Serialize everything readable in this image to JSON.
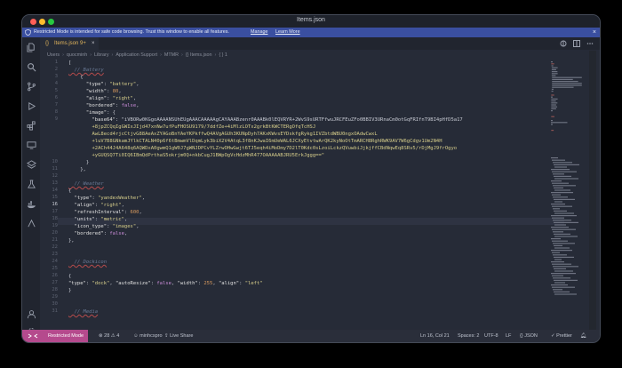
{
  "window": {
    "title": "Items.json"
  },
  "banner": {
    "message": "Restricted Mode is intended for safe code browsing. Trust this window to enable all features.",
    "manage": "Manage",
    "learn_more": "Learn More"
  },
  "activity": [
    "files-icon",
    "search-icon",
    "source-control-icon",
    "run-debug-icon",
    "extensions-icon",
    "remote-explorer-icon",
    "docker-icon",
    "testing-icon",
    "accounts-icon",
    "settings-icon"
  ],
  "tab": {
    "icon": "{}",
    "name": "Items.json",
    "badge": "9+",
    "close": "×"
  },
  "breadcrumbs": [
    "Users",
    "quocminh",
    "Library",
    "Application Support",
    "MTMR",
    "{} Items.json",
    "{ } 1"
  ],
  "lines": [
    {
      "n": "1",
      "t": "["
    },
    {
      "n": "2",
      "t": "  // Battery"
    },
    {
      "n": "3",
      "t": "    {"
    },
    {
      "n": "4",
      "t": "      \"type\": \"battery\","
    },
    {
      "n": "5",
      "t": "      \"width\": 80,"
    },
    {
      "n": "6",
      "t": "      \"align\": \"right\","
    },
    {
      "n": "7",
      "t": "      \"bordered\": false,"
    },
    {
      "n": "8",
      "t": "      \"image\": {"
    },
    {
      "n": "9",
      "t": "        \"base64\": \"iVBORw0KGgoAAAANSUhEUgAAACAAAAAgCAYAAABzenr0AAABk0lEQVRYR+2WvS9sURTFfwuJRCFEuZFo0BBIV3URnaCm0otGqFRIfnT9BI4pHfD5a17"
    },
    {
      "n": "",
      "t": "        +8jpZCQqIgGWIxJIjd47xnNw7ufPuFHOSU9179/7ddfZe+4iMlzLOTx2grkBtKWCTERgOfqTcHSJ"
    },
    {
      "n": "",
      "t": "        AwL8ecd4rjcCtjvG88AeAxZYAGoBnYAeYKPkffwQ4AVgAGUh3KUNpDyh7AKxKWvsEYDskfgRykg1IVZbtdWBU0ngxOAdwCwxL"
    },
    {
      "n": "",
      "t": "        +luV7B8GNkamJYlkCTALN40p6f6tBmwmVlDqmLyk3biX2V4AtqL3f8nKJwaI6mUeWAL6JCXyEtvtwArQK2kyNoOtTmARCH8RghRWK9AV7W6gCdgv1Um2N4H"
    },
    {
      "n": "",
      "t": "        +2ACh44J4A648q6AQWDxA0gwmQ1gW0J7gWNJDPCvYLZrwOHwGwjt6TJ5eqh4iMoDmy7D2lT0Kdc0sLzoiLckzQVuwbiJjkjffCBdNqwEq8SRv5/rDjMgJ9frOgyo"
    },
    {
      "n": "",
      "t": "        +yGUQSQ7Ti0IQ6IBmQdPrthaS5okrjm0Q+nkbCugJ1BWpOgVcHdzMhR477OAAAAABJRU5ErkJggg==\""
    },
    {
      "n": "10",
      "t": "      }"
    },
    {
      "n": "11",
      "t": "    },"
    },
    {
      "n": "12",
      "t": ""
    },
    {
      "n": "13",
      "t": "  // Weather"
    },
    {
      "n": "14",
      "t": "{"
    },
    {
      "n": "15",
      "t": "  \"type\": \"yandexWeather\","
    },
    {
      "n": "16",
      "t": "  \"align\": \"right\","
    },
    {
      "n": "17",
      "t": "  \"refreshInterval\": 600,"
    },
    {
      "n": "18",
      "t": "  \"units\": \"metric\","
    },
    {
      "n": "19",
      "t": "  \"icon_type\": \"images\","
    },
    {
      "n": "20",
      "t": "  \"bordered\": false,"
    },
    {
      "n": "21",
      "t": "},"
    },
    {
      "n": "22",
      "t": ""
    },
    {
      "n": "23",
      "t": ""
    },
    {
      "n": "24",
      "t": "  // Dockicon"
    },
    {
      "n": "25",
      "t": ""
    },
    {
      "n": "26",
      "t": "{"
    },
    {
      "n": "27",
      "t": "\"type\": \"dock\", \"autoResize\": false, \"width\": 255, \"align\": \"left\""
    },
    {
      "n": "28",
      "t": "}"
    },
    {
      "n": "29",
      "t": ""
    },
    {
      "n": "30",
      "t": ""
    },
    {
      "n": "31",
      "t": "  // Media"
    }
  ],
  "status": {
    "restricted": "Restricted Mode",
    "problems": "28 ⚠ 4",
    "user": "minhcspro",
    "live_share": "Live Share",
    "position": "Ln 16, Col 21",
    "spaces": "Spaces: 2",
    "encoding": "UTF-8",
    "eol": "LF",
    "language": "{} JSON",
    "prettier": "✓ Prettier"
  },
  "colors": {
    "banner": "#3a4fa0",
    "restricted": "#b54a8d",
    "editor": "#262b37"
  }
}
